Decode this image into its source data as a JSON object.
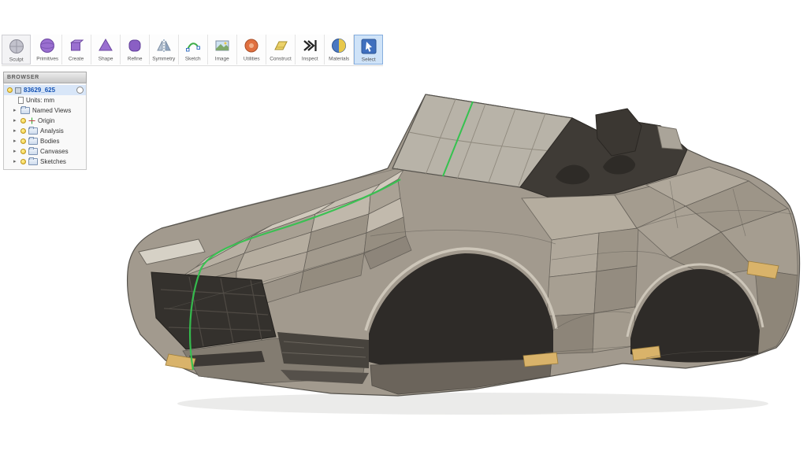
{
  "colors": {
    "accent_green": "#35c24f",
    "selection_blue": "#cfe3f8",
    "body_grey": "#a29a8e",
    "arch_dark": "#2e2b28",
    "tan_block": "#d9b36a"
  },
  "toolbar": {
    "items": [
      {
        "label": "Sculpt",
        "icon": "sculpt-icon"
      },
      {
        "label": "Primitives",
        "icon": "primitives-icon"
      },
      {
        "label": "Create",
        "icon": "create-icon"
      },
      {
        "label": "Shape",
        "icon": "shape-icon"
      },
      {
        "label": "Refine",
        "icon": "refine-icon"
      },
      {
        "label": "Symmetry",
        "icon": "symmetry-icon"
      },
      {
        "label": "Sketch",
        "icon": "sketch-icon"
      },
      {
        "label": "Image",
        "icon": "image-icon"
      },
      {
        "label": "Utilities",
        "icon": "utilities-icon"
      },
      {
        "label": "Construct",
        "icon": "construct-icon"
      },
      {
        "label": "Inspect",
        "icon": "inspect-icon"
      },
      {
        "label": "Materials",
        "icon": "materials-icon"
      },
      {
        "label": "Select",
        "icon": "select-icon",
        "selected": true
      }
    ]
  },
  "browser": {
    "title": "BROWSER",
    "root": {
      "label": "83629_625"
    },
    "items": [
      {
        "label": "Units: mm"
      },
      {
        "label": "Named Views"
      },
      {
        "label": "Origin"
      },
      {
        "label": "Analysis"
      },
      {
        "label": "Bodies"
      },
      {
        "label": "Canvases"
      },
      {
        "label": "Sketches"
      }
    ]
  }
}
